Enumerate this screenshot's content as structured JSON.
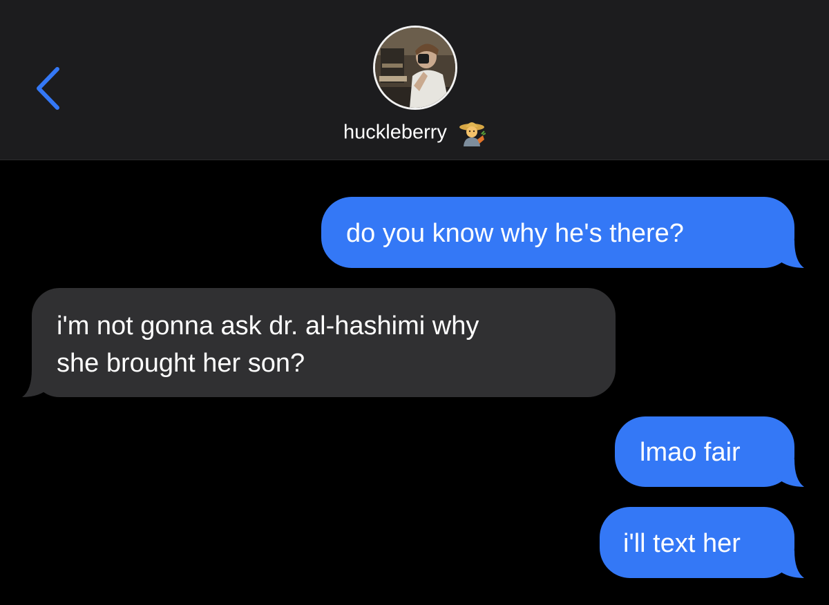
{
  "header": {
    "contact_name": "huckleberry",
    "contact_emoji": "farmer-emoji",
    "avatar_icon": "contact-photo",
    "back_icon": "chevron-left-icon"
  },
  "colors": {
    "accent": "#3478f6",
    "outgoing_bubble": "#3478f6",
    "incoming_bubble": "#303032",
    "header_background": "#1c1c1e",
    "background": "#000000"
  },
  "messages": [
    {
      "direction": "outgoing",
      "text": "do you know why he's there?"
    },
    {
      "direction": "incoming",
      "lines": [
        "i'm not gonna ask dr. al-hashimi why",
        "she brought her son?"
      ]
    },
    {
      "direction": "outgoing",
      "text": "lmao fair"
    },
    {
      "direction": "outgoing",
      "text": "i'll text her"
    }
  ]
}
